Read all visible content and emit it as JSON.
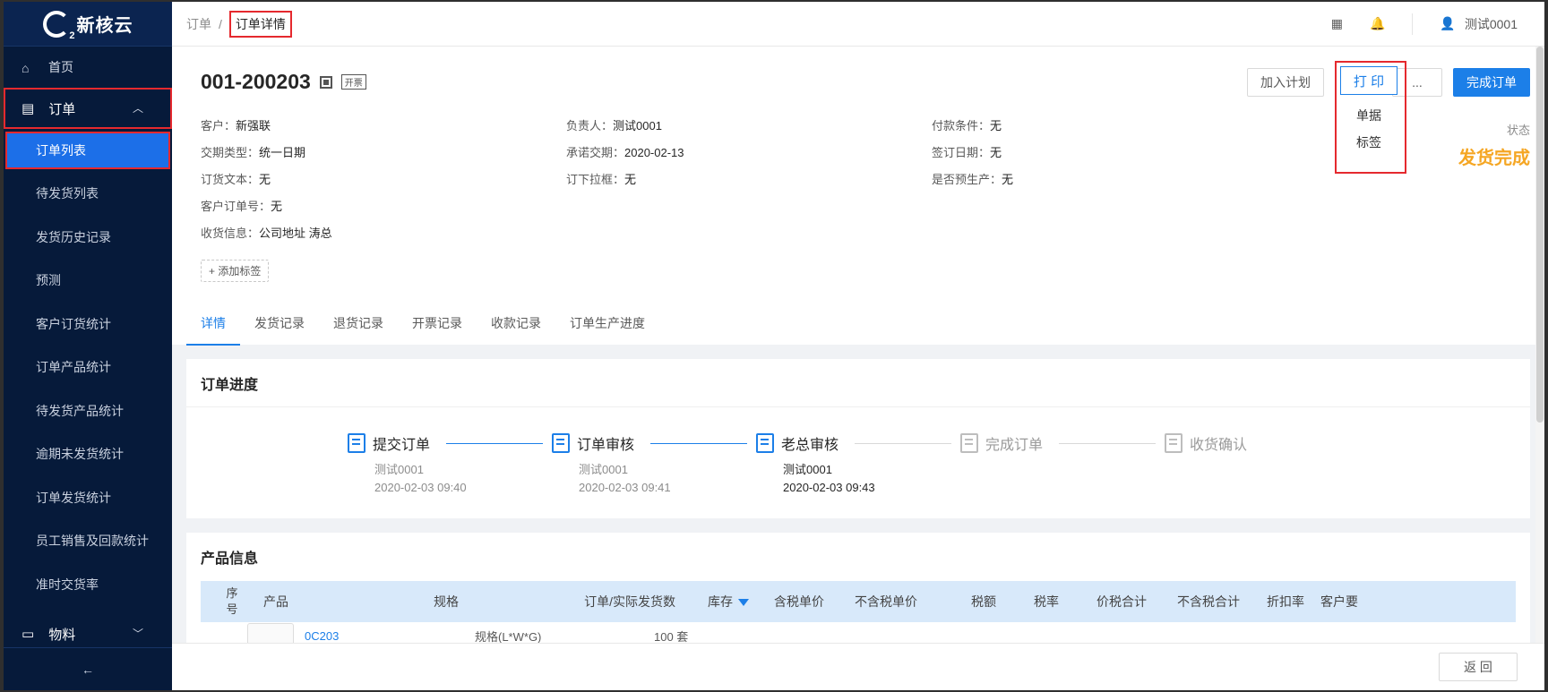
{
  "sidebar": {
    "logo_text": "新核云",
    "home": "首页",
    "order_group": "订单",
    "order_items": [
      "订单列表",
      "待发货列表",
      "发货历史记录",
      "预测",
      "客户订货统计",
      "订单产品统计",
      "待发货产品统计",
      "逾期未发货统计",
      "订单发货统计",
      "员工销售及回款统计",
      "准时交货率"
    ],
    "material_group": "物料",
    "collapse": "←"
  },
  "header": {
    "breadcrumb_parent": "订单",
    "breadcrumb_sep": "/",
    "breadcrumb_current": "订单详情",
    "user_name": "测试0001"
  },
  "order": {
    "number": "001-200203",
    "invoice_tag": "开票",
    "actions": {
      "add_plan": "加入计划",
      "print": "打 印",
      "more": "...",
      "complete": "完成订单"
    },
    "print_menu": [
      "单据",
      "标签"
    ],
    "status_label": "状态",
    "status_value": "发货完成",
    "info": [
      {
        "k": "客户：",
        "v": "新强联"
      },
      {
        "k": "负责人：",
        "v": "测试0001"
      },
      {
        "k": "付款条件：",
        "v": "无"
      },
      {
        "k": "交期类型：",
        "v": "统一日期"
      },
      {
        "k": "承诺交期：",
        "v": "2020-02-13"
      },
      {
        "k": "签订日期：",
        "v": "无"
      },
      {
        "k": "订货文本：",
        "v": "无"
      },
      {
        "k": "订下拉框：",
        "v": "无"
      },
      {
        "k": "是否预生产：",
        "v": "无"
      },
      {
        "k": "客户订单号：",
        "v": "无"
      },
      {
        "k": "",
        "v": ""
      },
      {
        "k": "",
        "v": ""
      },
      {
        "k": "收货信息：",
        "v": "公司地址 涛总"
      }
    ],
    "add_tag": "+ 添加标签",
    "tabs": [
      "详情",
      "发货记录",
      "退货记录",
      "开票记录",
      "收款记录",
      "订单生产进度"
    ]
  },
  "progress": {
    "title": "订单进度",
    "steps": [
      {
        "name": "提交订单",
        "user": "测试0001",
        "time": "2020-02-03 09:40"
      },
      {
        "name": "订单审核",
        "user": "测试0001",
        "time": "2020-02-03 09:41"
      },
      {
        "name": "老总审核",
        "user": "测试0001",
        "time": "2020-02-03 09:43"
      },
      {
        "name": "完成订单",
        "user": "",
        "time": ""
      },
      {
        "name": "收货确认",
        "user": "",
        "time": ""
      }
    ]
  },
  "products": {
    "title": "产品信息",
    "columns": [
      "序\n号",
      "产品",
      "规格",
      "订单/实际发货数",
      "库存",
      "含税单价",
      "不含税单价",
      "税额",
      "税率",
      "价税合计",
      "不含税合计",
      "折扣率",
      "客户要"
    ],
    "row_partial": {
      "product": "0C203",
      "spec": "规格(L*W*G)",
      "qty": "100 套"
    }
  },
  "footer": {
    "back": "返 回"
  }
}
